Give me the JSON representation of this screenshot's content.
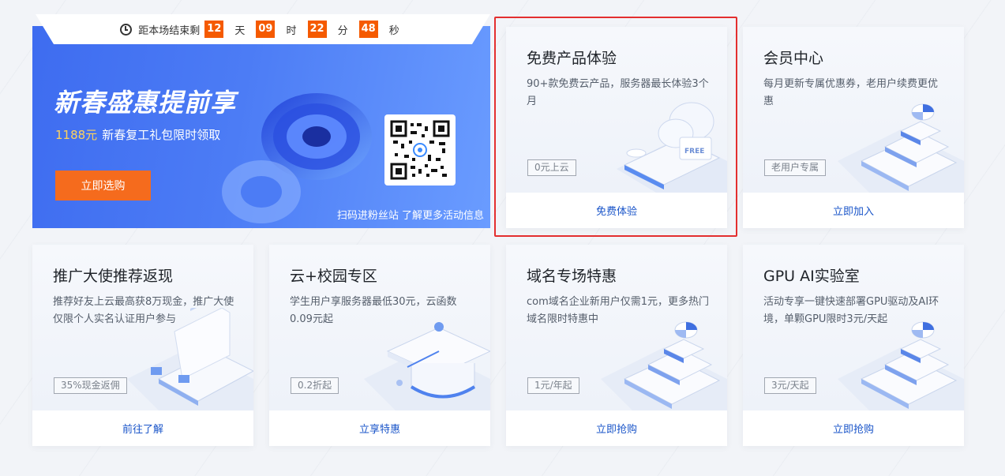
{
  "countdown": {
    "prefix": "距本场结束剩",
    "days": "12",
    "days_unit": "天",
    "hours": "09",
    "hours_unit": "时",
    "minutes": "22",
    "minutes_unit": "分",
    "seconds": "48",
    "seconds_unit": "秒"
  },
  "banner": {
    "title": "新春盛惠提前享",
    "amount": "1188元",
    "subtitle": "新春复工礼包限时领取",
    "button": "立即选购",
    "qr_caption": "扫码进粉丝站 了解更多活动信息"
  },
  "cards": [
    {
      "title": "免费产品体验",
      "desc": "90+款免费云产品，服务器最长体验3个月",
      "tag": "0元上云",
      "action": "免费体验",
      "icon": "cloud-free-icon"
    },
    {
      "title": "会员中心",
      "desc": "每月更新专属优惠券，老用户续费更优惠",
      "tag": "老用户专属",
      "action": "立即加入",
      "icon": "stack-pie-icon"
    },
    {
      "title": "推广大使推荐返现",
      "desc": "推荐好友上云最高获8万现金，推广大使仅限个人实名认证用户参与",
      "tag": "35%现金返佣",
      "action": "前往了解",
      "icon": "panel-icon"
    },
    {
      "title": "云+校园专区",
      "desc": "学生用户享服务器最低30元，云函数0.09元起",
      "tag": "0.2折起",
      "action": "立享特惠",
      "icon": "graduation-cap-icon"
    },
    {
      "title": "域名专场特惠",
      "desc": "com域名企业新用户仅需1元，更多热门域名限时特惠中",
      "tag": "1元/年起",
      "action": "立即抢购",
      "icon": "stack-pie-icon"
    },
    {
      "title": "GPU AI实验室",
      "desc": "活动专享一键快速部署GPU驱动及AI环境，单颗GPU限时3元/天起",
      "tag": "3元/天起",
      "action": "立即抢购",
      "icon": "stack-pie-icon"
    }
  ],
  "colors": {
    "accent": "#f56b1d",
    "link": "#1a55c9",
    "highlight": "#e32f2f",
    "banner": "#4c7cf5"
  }
}
